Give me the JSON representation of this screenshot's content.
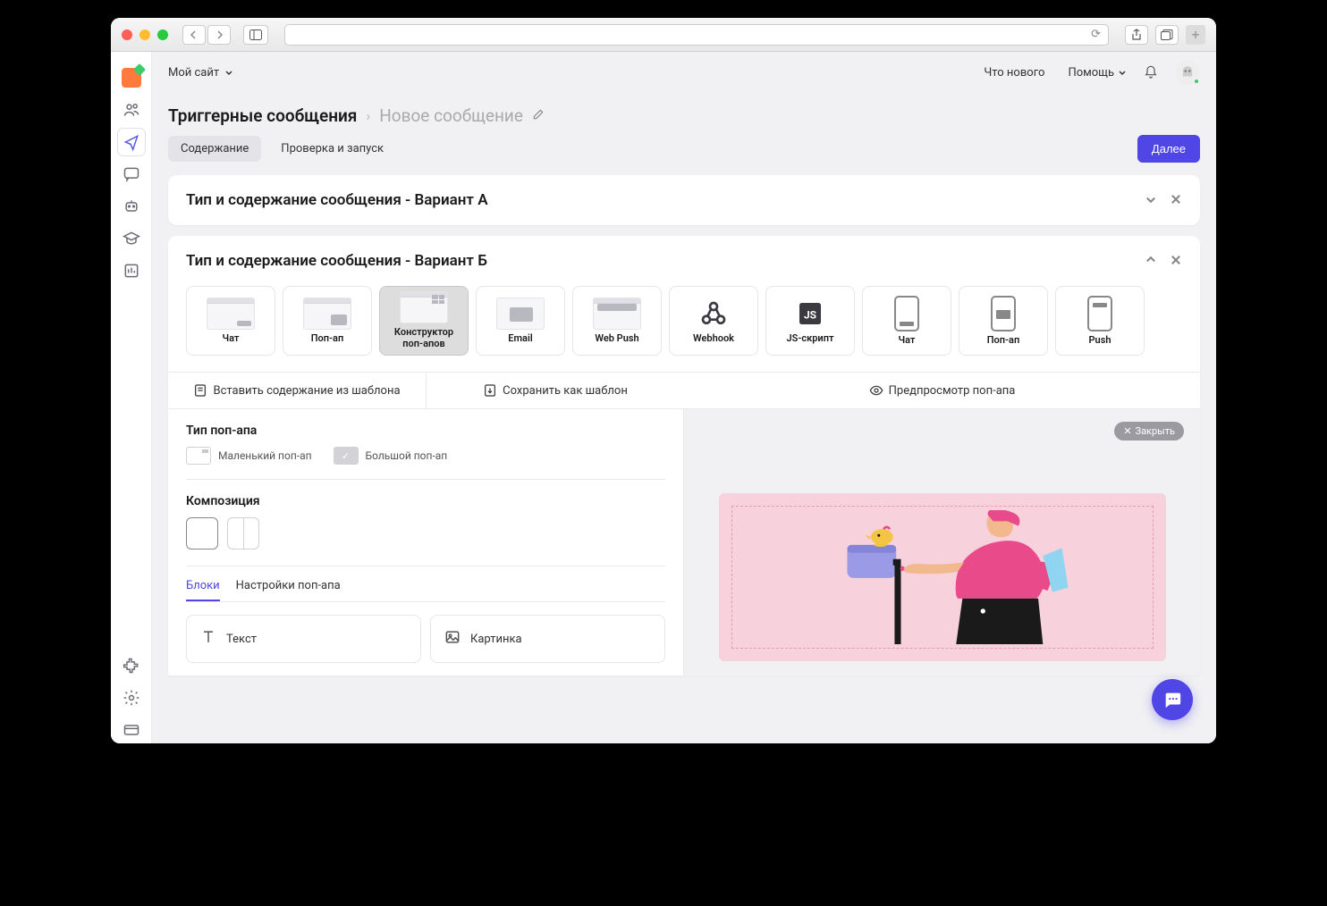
{
  "header": {
    "site_label": "Мой сайт",
    "whats_new": "Что нового",
    "help": "Помощь"
  },
  "breadcrumb": {
    "parent": "Триггерные сообщения",
    "current": "Новое сообщение"
  },
  "steps": {
    "content": "Содержание",
    "review": "Проверка и запуск",
    "next": "Далее"
  },
  "variant_a": {
    "title": "Тип и содержание сообщения - Вариант А"
  },
  "variant_b": {
    "title": "Тип и содержание сообщения - Вариант Б",
    "types": [
      {
        "label": "Чат"
      },
      {
        "label": "Поп-ап"
      },
      {
        "label": "Конструктор поп-апов"
      },
      {
        "label": "Email"
      },
      {
        "label": "Web Push"
      },
      {
        "label": "Webhook"
      },
      {
        "label": "JS-скрипт"
      },
      {
        "label": "Чат"
      },
      {
        "label": "Поп-ап"
      },
      {
        "label": "Push"
      }
    ],
    "toolbar": {
      "insert_template": "Вставить содержание из шаблона",
      "save_template": "Сохранить как шаблон",
      "preview": "Предпросмотр поп-апа"
    },
    "popup_type": {
      "title": "Тип поп-апа",
      "small": "Маленький поп-ап",
      "big": "Большой поп-ап"
    },
    "composition": {
      "title": "Композиция"
    },
    "tabs": {
      "blocks": "Блоки",
      "settings": "Настройки поп-апа"
    },
    "blocks": {
      "text": "Текст",
      "image": "Картинка"
    },
    "close_label": "Закрыть"
  }
}
